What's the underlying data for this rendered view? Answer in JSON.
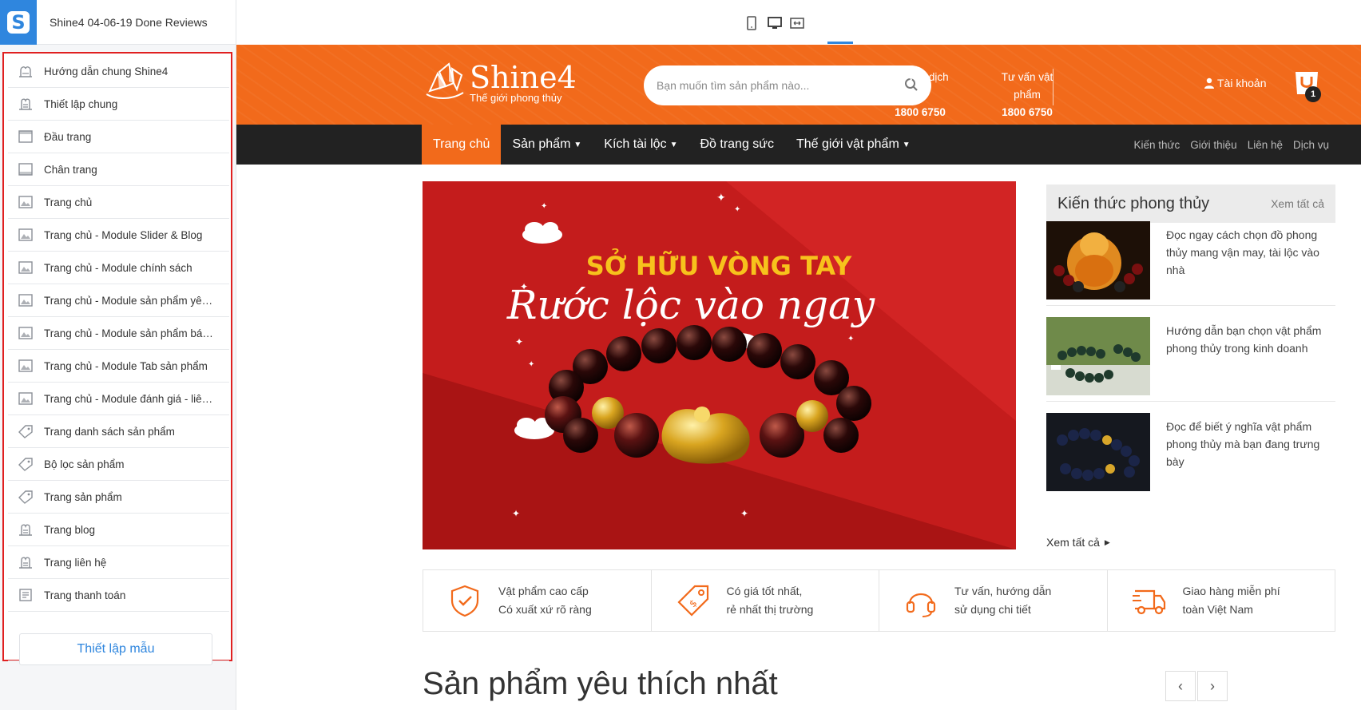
{
  "editor": {
    "title": "Shine4 04-06-19 Done Reviews",
    "menu": [
      {
        "label": "Hướng dẫn chung Shine4",
        "icon": "guide-icon"
      },
      {
        "label": "Thiết lập chung",
        "icon": "settings-icon"
      },
      {
        "label": "Đầu trang",
        "icon": "header-layout-icon"
      },
      {
        "label": "Chân trang",
        "icon": "footer-layout-icon"
      },
      {
        "label": "Trang chủ",
        "icon": "page-image-icon"
      },
      {
        "label": "Trang chủ - Module Slider & Blog",
        "icon": "page-image-icon"
      },
      {
        "label": "Trang chủ - Module chính sách",
        "icon": "page-image-icon"
      },
      {
        "label": "Trang chủ - Module sản phẩm yêu thích",
        "icon": "page-image-icon"
      },
      {
        "label": "Trang chủ - Module sản phẩm bán chạy",
        "icon": "page-image-icon"
      },
      {
        "label": "Trang chủ - Module Tab sản phẩm",
        "icon": "page-image-icon"
      },
      {
        "label": "Trang chủ - Module đánh giá - liên hệ",
        "icon": "page-image-icon"
      },
      {
        "label": "Trang danh sách sản phẩm",
        "icon": "tag-icon"
      },
      {
        "label": "Bộ lọc sản phẩm",
        "icon": "tag-icon"
      },
      {
        "label": "Trang sản phẩm",
        "icon": "tag-icon"
      },
      {
        "label": "Trang blog",
        "icon": "settings-icon"
      },
      {
        "label": "Trang liên hệ",
        "icon": "settings-icon"
      },
      {
        "label": "Trang thanh toán",
        "icon": "checkout-icon"
      }
    ],
    "setup_button": "Thiết lập mẫu"
  },
  "site": {
    "logo_name": "Shine4",
    "logo_tagline": "Thế giới phong thủy",
    "search_placeholder": "Bạn muốn tìm sản phẩm nào...",
    "hotlines": [
      {
        "label": "Tư vấn dịch vụ",
        "number": "1800 6750"
      },
      {
        "label": "Tư vấn vật phẩm",
        "number": "1800 6750"
      }
    ],
    "account_label": "Tài khoản",
    "cart_count": "1",
    "nav_main": [
      {
        "label": "Trang chủ",
        "active": true,
        "dropdown": false
      },
      {
        "label": "Sản phẩm",
        "active": false,
        "dropdown": true
      },
      {
        "label": "Kích tài lộc",
        "active": false,
        "dropdown": true
      },
      {
        "label": "Đồ trang sức",
        "active": false,
        "dropdown": false
      },
      {
        "label": "Thế giới vật phẩm",
        "active": false,
        "dropdown": true
      }
    ],
    "nav_right": [
      "Kiến thức",
      "Giới thiệu",
      "Liên hệ",
      "Dịch vụ"
    ],
    "banner": {
      "headline": "SỞ HỮU VÒNG TAY",
      "script": "Rước lộc vào ngay"
    },
    "knowledge": {
      "title": "Kiến thức phong thủy",
      "view_all": "Xem tất cả",
      "articles": [
        {
          "title": "Đọc ngay cách chọn đồ phong thủy mang vận may, tài lộc vào nhà"
        },
        {
          "title": "Hướng dẫn bạn chọn vật phẩm phong thủy trong kinh doanh"
        },
        {
          "title": "Đọc để biết ý nghĩa vật phẩm phong thủy mà bạn đang trưng bày"
        }
      ],
      "more": "Xem tất cả"
    },
    "features": [
      {
        "line1": "Vật phẩm cao cấp",
        "line2": "Có xuất xứ rõ ràng",
        "icon": "shield-check-icon"
      },
      {
        "line1": "Có giá tốt nhất,",
        "line2": "rẻ nhất thị trường",
        "icon": "price-tag-icon"
      },
      {
        "line1": "Tư vấn, hướng dẫn",
        "line2": "sử dụng chi tiết",
        "icon": "headset-icon"
      },
      {
        "line1": "Giao hàng miễn phí",
        "line2": "toàn Việt Nam",
        "icon": "truck-icon"
      }
    ],
    "section_title": "Sản phẩm yêu thích nhất"
  },
  "colors": {
    "brand_orange": "#f26a1b",
    "nav_dark": "#222222",
    "editor_accent": "#2f86de",
    "highlight_border": "#e02020",
    "banner_red": "#c41c1c",
    "headline_yellow": "#f7c21c"
  }
}
